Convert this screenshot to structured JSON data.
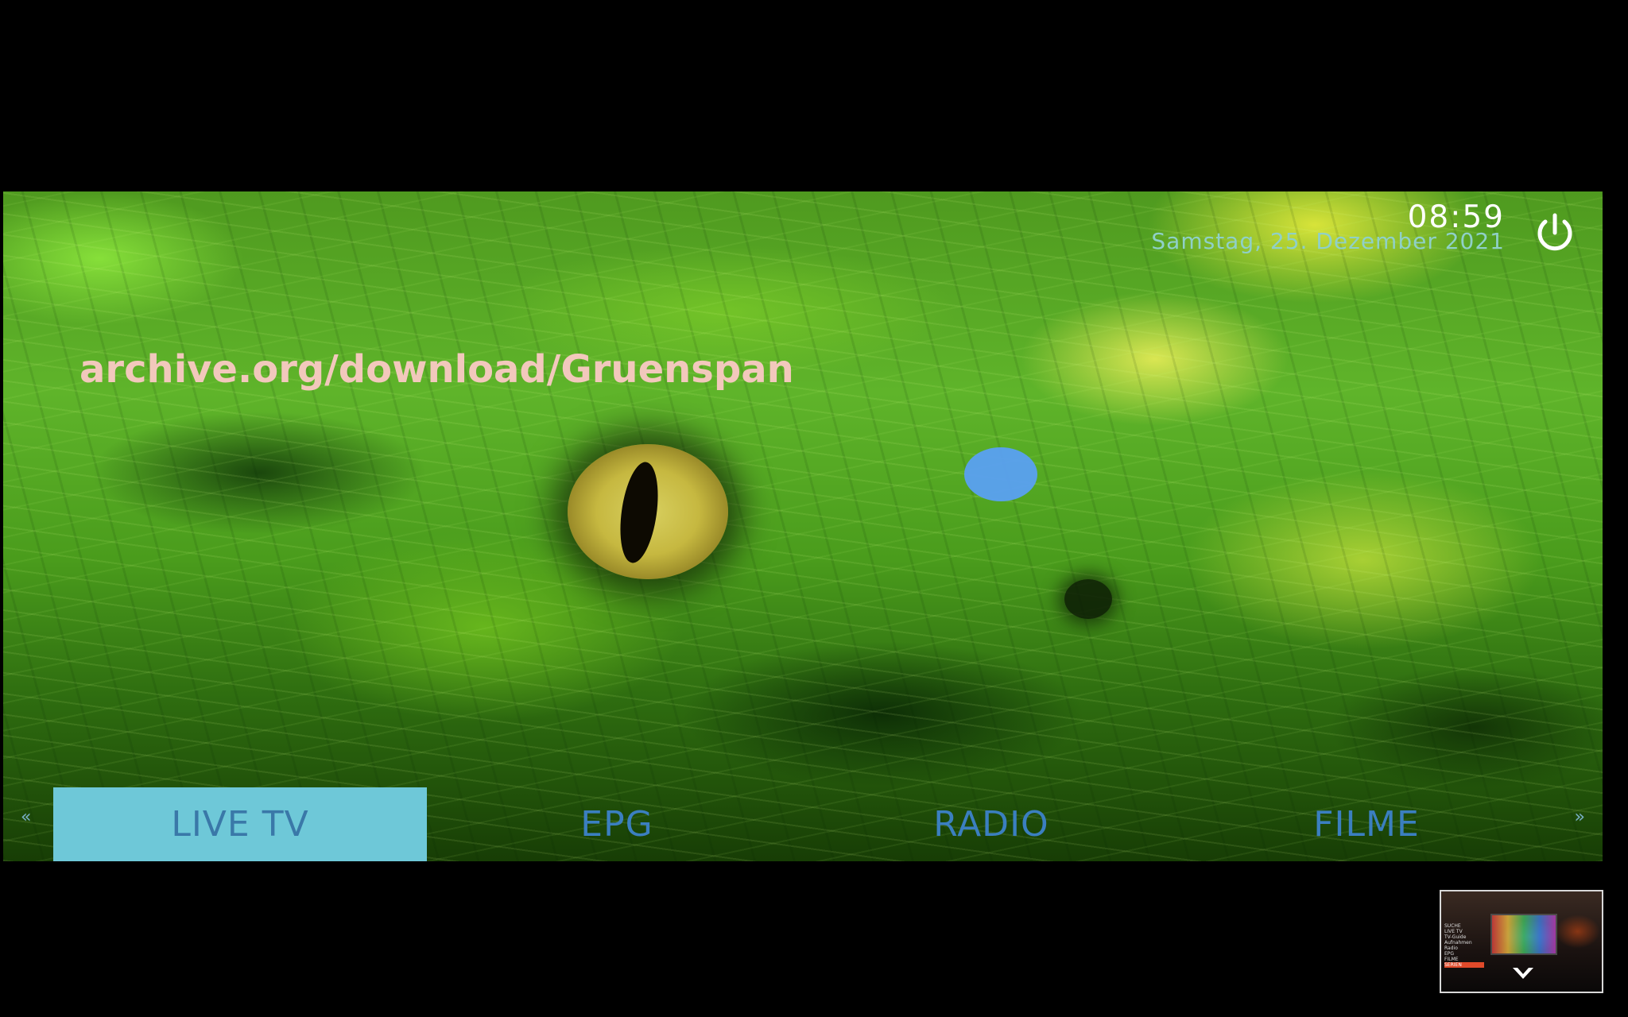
{
  "clock": {
    "time": "08:59",
    "date": "Samstag, 25. Dezember 2021"
  },
  "header": {
    "power_icon": "power-icon"
  },
  "overlay": {
    "url_text": "archive.org/download/Gruenspan"
  },
  "menu": {
    "items": [
      {
        "label": "LIVE TV",
        "selected": true
      },
      {
        "label": "EPG",
        "selected": false
      },
      {
        "label": "RADIO",
        "selected": false
      },
      {
        "label": "FILME",
        "selected": false
      }
    ],
    "left_arrow": "«",
    "right_arrow": "»"
  },
  "preview": {
    "menu_items": [
      "SUCHE",
      "LIVE TV",
      "TV-Guide",
      "Aufnahmen",
      "Radio",
      "EPG",
      "FILME",
      "SERIEN"
    ],
    "selected_index": 7
  },
  "colors": {
    "menu_text": "#3b7fc0",
    "menu_selected_bg": "#6ec8d8",
    "url_text": "#f2c8bc",
    "clock_text": "#ffffff",
    "date_text": "#8fd0c8",
    "cursor": "#5aa0f2"
  }
}
